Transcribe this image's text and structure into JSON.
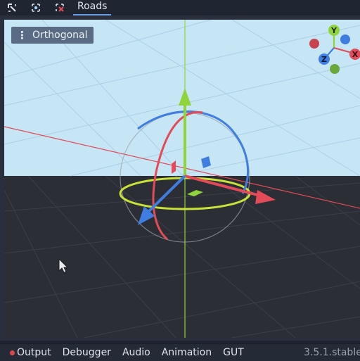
{
  "toolbar": {
    "icons": [
      "select-tool-icon",
      "move-tool-icon",
      "delete-tool-icon"
    ],
    "tab_label": "Roads"
  },
  "viewport": {
    "view_menu_label": "Orthogonal",
    "gizmo_axes": {
      "x": "X",
      "y": "Y",
      "z": "Z"
    },
    "colors": {
      "sky": "#c6e6f6",
      "ground": "#2b2d34",
      "x_axis": "#e24b57",
      "y_axis": "#8fd43a",
      "z_axis": "#3f7ee0"
    }
  },
  "bottom_panel": {
    "tabs": [
      "Output",
      "Debugger",
      "Audio",
      "Animation",
      "GUT"
    ],
    "version": "3.5.1.stable"
  }
}
